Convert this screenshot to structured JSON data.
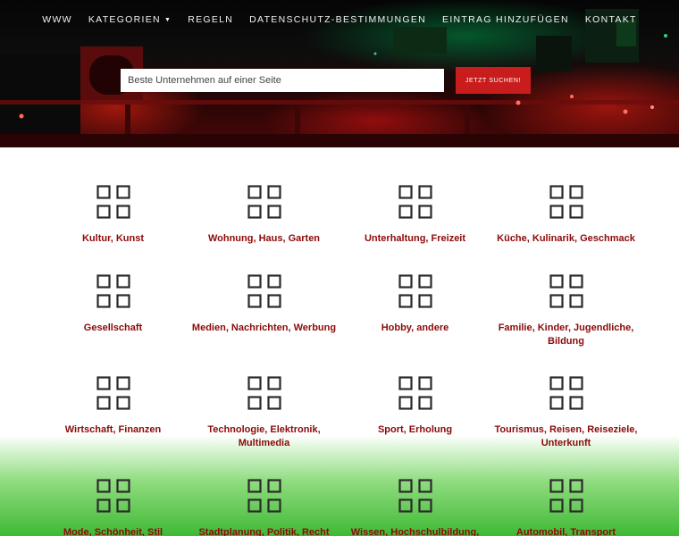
{
  "nav": {
    "items": [
      {
        "label": "WWW"
      },
      {
        "label": "KATEGORIEN",
        "has_dropdown": true
      },
      {
        "label": "REGELN"
      },
      {
        "label": "DATENSCHUTZ-BESTIMMUNGEN"
      },
      {
        "label": "EINTRAG HINZUFÜGEN"
      },
      {
        "label": "KONTAKT"
      }
    ]
  },
  "search": {
    "placeholder": "Beste Unternehmen auf einer Seite",
    "button_label": "JETZT SUCHEN!"
  },
  "colors": {
    "accent_red": "#c91c1c",
    "category_label": "#8b0a0a",
    "icon_stroke": "#2a2a2a"
  },
  "categories": [
    {
      "label": "Kultur, Kunst",
      "icon": "grid-icon"
    },
    {
      "label": "Wohnung, Haus, Garten",
      "icon": "grid-icon"
    },
    {
      "label": "Unterhaltung, Freizeit",
      "icon": "grid-icon"
    },
    {
      "label": "Küche, Kulinarik, Geschmack",
      "icon": "grid-icon"
    },
    {
      "label": "Gesellschaft",
      "icon": "grid-icon"
    },
    {
      "label": "Medien, Nachrichten, Werbung",
      "icon": "grid-icon"
    },
    {
      "label": "Hobby, andere",
      "icon": "grid-icon"
    },
    {
      "label": "Familie, Kinder, Jugendliche, Bildung",
      "icon": "grid-icon"
    },
    {
      "label": "Wirtschaft, Finanzen",
      "icon": "grid-icon"
    },
    {
      "label": "Technologie, Elektronik, Multimedia",
      "icon": "grid-icon"
    },
    {
      "label": "Sport, Erholung",
      "icon": "grid-icon"
    },
    {
      "label": "Tourismus, Reisen, Reiseziele, Unterkunft",
      "icon": "grid-icon"
    },
    {
      "label": "Mode, Schönheit, Stil",
      "icon": "grid-icon"
    },
    {
      "label": "Stadtplanung, Politik, Recht",
      "icon": "grid-icon"
    },
    {
      "label": "Wissen, Hochschulbildung,",
      "icon": "grid-icon"
    },
    {
      "label": "Automobil, Transport",
      "icon": "grid-icon"
    }
  ]
}
